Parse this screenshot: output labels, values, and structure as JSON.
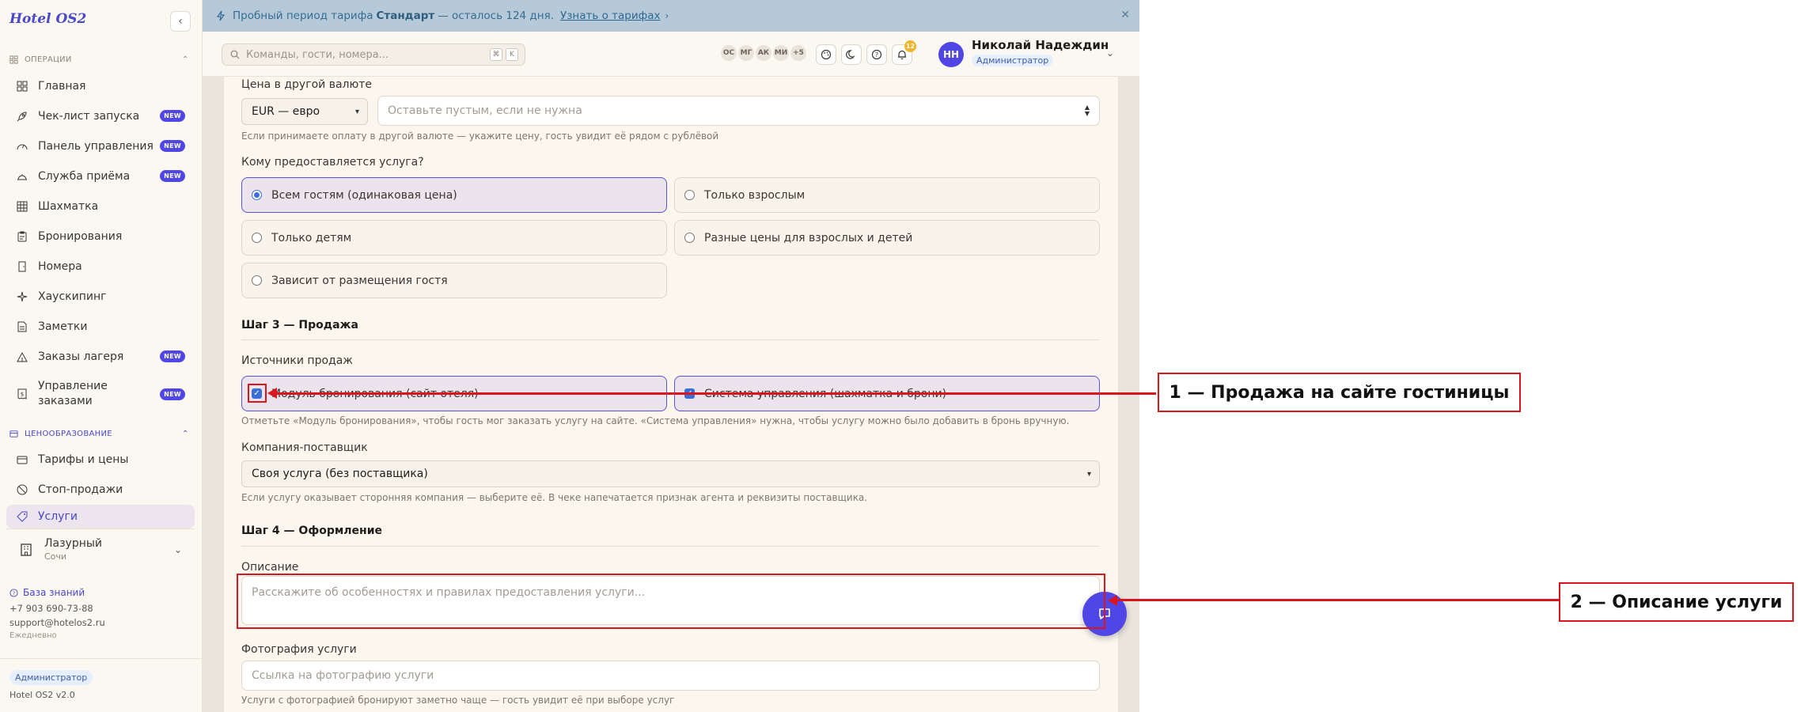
{
  "app": {
    "brand": "Hotel OS2"
  },
  "sidebar": {
    "ops_section": "ОПЕРАЦИИ",
    "pricing_section": "ЦЕНООБРАЗОВАНИЕ",
    "new_badge": "NEW",
    "ops_items": [
      {
        "label": "Главная",
        "icon": "grid-icon",
        "new": false
      },
      {
        "label": "Чек-лист запуска",
        "icon": "rocket-icon",
        "new": true
      },
      {
        "label": "Панель управления",
        "icon": "gauge-icon",
        "new": true
      },
      {
        "label": "Служба приёма",
        "icon": "bell-service-icon",
        "new": true
      },
      {
        "label": "Шахматка",
        "icon": "table-grid-icon",
        "new": false
      },
      {
        "label": "Бронирования",
        "icon": "clipboard-icon",
        "new": false
      },
      {
        "label": "Номера",
        "icon": "door-icon",
        "new": false
      },
      {
        "label": "Хаускипинг",
        "icon": "sparkle-icon",
        "new": false
      },
      {
        "label": "Заметки",
        "icon": "note-icon",
        "new": false
      },
      {
        "label": "Заказы лагеря",
        "icon": "tent-icon",
        "new": true
      },
      {
        "label": "Управление заказами",
        "icon": "receipt-icon",
        "new": true
      }
    ],
    "pricing_items": [
      {
        "label": "Тарифы и цены",
        "icon": "card-icon"
      },
      {
        "label": "Стоп-продажи",
        "icon": "ban-icon"
      },
      {
        "label": "Услуги",
        "icon": "tag-icon",
        "active": true
      }
    ],
    "hotel": {
      "name": "Лазурный",
      "city": "Сочи"
    },
    "contacts": {
      "kb": "База знаний",
      "phone": "+7 903 690-73-88",
      "email": "support@hotelos2.ru",
      "schedule": "Ежедневно"
    },
    "role": "Администратор",
    "version": "Hotel OS2 v2.0"
  },
  "banner": {
    "prefix": "Пробный период тарифа",
    "plan": "Стандарт",
    "suffix": "— осталось 124 дня.",
    "link": "Узнать о тарифах",
    "colors": {
      "bg": "#b6c9d9",
      "text": "#356d92"
    }
  },
  "header": {
    "search_placeholder": "Команды, гости, номера...",
    "kbd1": "⌘",
    "kbd2": "K",
    "presence": [
      "ОС",
      "МГ",
      "АК",
      "МИ",
      "+5"
    ],
    "notif_count": "12",
    "user_name": "Николай Надеждин",
    "user_role": "Администратор",
    "user_initials": "НН"
  },
  "form": {
    "currency_label": "Цена в другой валюте",
    "currency_value": "EUR — евро",
    "currency_placeholder": "Оставьте пустым, если не нужна",
    "currency_hint": "Если принимаете оплату в другой валюте — укажите цену, гость увидит её рядом с рублёвой",
    "audience_label": "Кому предоставляется услуга?",
    "audience_options": [
      {
        "label": "Всем гостям (одинаковая цена)",
        "selected": true
      },
      {
        "label": "Только взрослым",
        "selected": false
      },
      {
        "label": "Только детям",
        "selected": false
      },
      {
        "label": "Разные цены для взрослых и детей",
        "selected": false
      },
      {
        "label": "Зависит от размещения гостя",
        "selected": false
      }
    ],
    "step3_title": "Шаг 3 — Продажа",
    "sources_label": "Источники продаж",
    "sources": [
      {
        "label": "Модуль бронирования (сайт отеля)",
        "checked": true
      },
      {
        "label": "Система управления (шахматка и брони)",
        "checked": true
      }
    ],
    "sources_hint": "Отметьте «Модуль бронирования», чтобы гость мог заказать услугу на сайте. «Система управления» нужна, чтобы услугу можно было добавить в бронь вручную.",
    "supplier_label": "Компания-поставщик",
    "supplier_value": "Своя услуга (без поставщика)",
    "supplier_hint": "Если услугу оказывает сторонняя компания — выберите её. В чеке напечатается признак агента и реквизиты поставщика.",
    "step4_title": "Шаг 4 — Оформление",
    "desc_label": "Описание",
    "desc_placeholder": "Расскажите об особенностях и правилах предоставления услуги...",
    "photo_label": "Фотография услуги",
    "photo_placeholder": "Ссылка на фотографию услуги",
    "photo_hint": "Услуги с фотографией бронируют заметно чаще — гость увидит её при выборе услуг"
  },
  "annotations": {
    "callout1": "1 — Продажа на сайте гостиницы",
    "callout2": "2 — Описание услуги",
    "color": "#d9161d"
  }
}
